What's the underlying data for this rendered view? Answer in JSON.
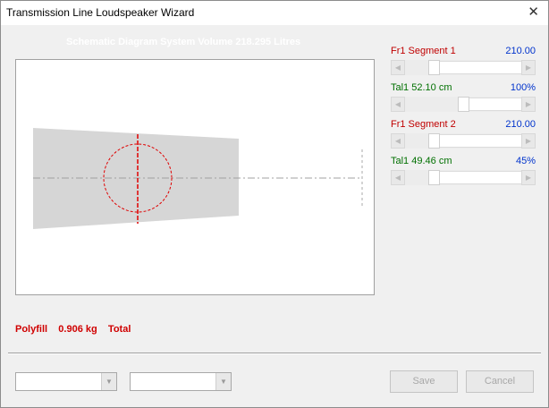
{
  "window": {
    "title": "Transmission Line Loudspeaker Wizard",
    "close_glyph": "✕"
  },
  "diagram": {
    "caption": "Schematic Diagram   System Volume 218.295 Litres"
  },
  "params": [
    {
      "label": "Fr1  Segment 1",
      "value": "210.00",
      "label_color": "#c00000",
      "slider_fraction": 0.22
    },
    {
      "label": "Tal1  52.10 cm",
      "value": "100%",
      "label_color": "#007000",
      "slider_fraction": 0.5
    },
    {
      "label": "Fr1  Segment 2",
      "value": "210.00",
      "label_color": "#c00000",
      "slider_fraction": 0.22
    },
    {
      "label": "Tal1  49.46 cm",
      "value": "45%",
      "label_color": "#007000",
      "slider_fraction": 0.22
    }
  ],
  "polyfill": {
    "text": "Polyfill    0.906 kg    Total"
  },
  "controls": {
    "combo1_value": "",
    "combo2_value": "",
    "save_label": "Save",
    "cancel_label": "Cancel"
  }
}
